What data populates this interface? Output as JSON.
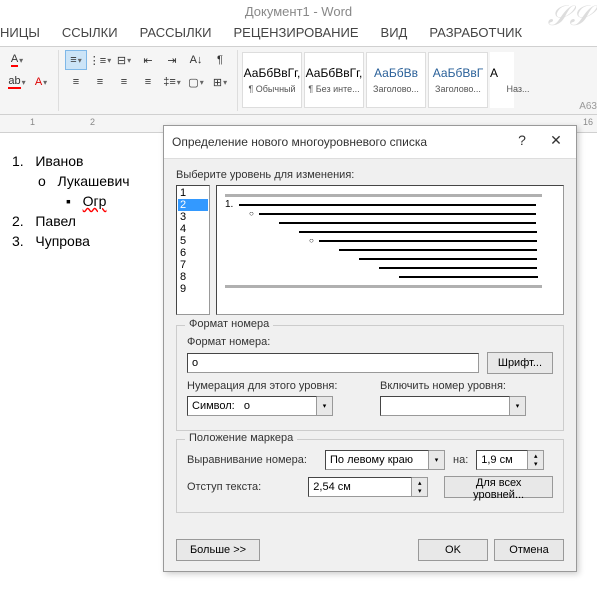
{
  "app_title": "Документ1 - Word",
  "ribbon_tabs": [
    "НИЦЫ",
    "ССЫЛКИ",
    "РАССЫЛКИ",
    "РЕЦЕНЗИРОВАНИЕ",
    "ВИД",
    "РАЗРАБОТЧИК"
  ],
  "styles": [
    {
      "preview": "АаБбВвГг,",
      "name": "¶ Обычный"
    },
    {
      "preview": "АаБбВвГг,",
      "name": "¶ Без инте..."
    },
    {
      "preview": "АаБбВв",
      "name": "Заголово...",
      "blue": true
    },
    {
      "preview": "АаБбВвГ",
      "name": "Заголово...",
      "blue": true
    },
    {
      "preview": "А",
      "name": "Наз..."
    }
  ],
  "ruler": {
    "tab_label": "А63",
    "marks": [
      "1",
      "2",
      "16"
    ]
  },
  "document": {
    "items": [
      {
        "level": 1,
        "num": "1.",
        "text": "Иванов"
      },
      {
        "level": 2,
        "num": "o",
        "text": "Лукашевич"
      },
      {
        "level": 3,
        "num": "▪",
        "text": "Огр"
      },
      {
        "level": 1,
        "num": "2.",
        "text": "Павел"
      },
      {
        "level": 1,
        "num": "3.",
        "text": "Чупрова"
      }
    ]
  },
  "dialog": {
    "title": "Определение нового многоуровневого списка",
    "help": "?",
    "close": "✕",
    "level_label": "Выберите уровень для изменения:",
    "levels": [
      "1",
      "2",
      "3",
      "4",
      "5",
      "6",
      "7",
      "8",
      "9"
    ],
    "selected_level": "2",
    "preview_num": "1.",
    "format_section": "Формат номера",
    "format_label": "Формат номера:",
    "format_value": "o",
    "font_btn": "Шрифт...",
    "numbering_label": "Нумерация для этого уровня:",
    "numbering_value": "Символ:   o",
    "include_label": "Включить номер уровня:",
    "include_value": "",
    "position_section": "Положение маркера",
    "align_label": "Выравнивание номера:",
    "align_value": "По левому краю",
    "at_label": "на:",
    "at_value": "1,9 см",
    "indent_label": "Отступ текста:",
    "indent_value": "2,54 см",
    "all_levels_btn": "Для всех уровней...",
    "more_btn": "Больше >>",
    "ok_btn": "OK",
    "cancel_btn": "Отмена"
  }
}
